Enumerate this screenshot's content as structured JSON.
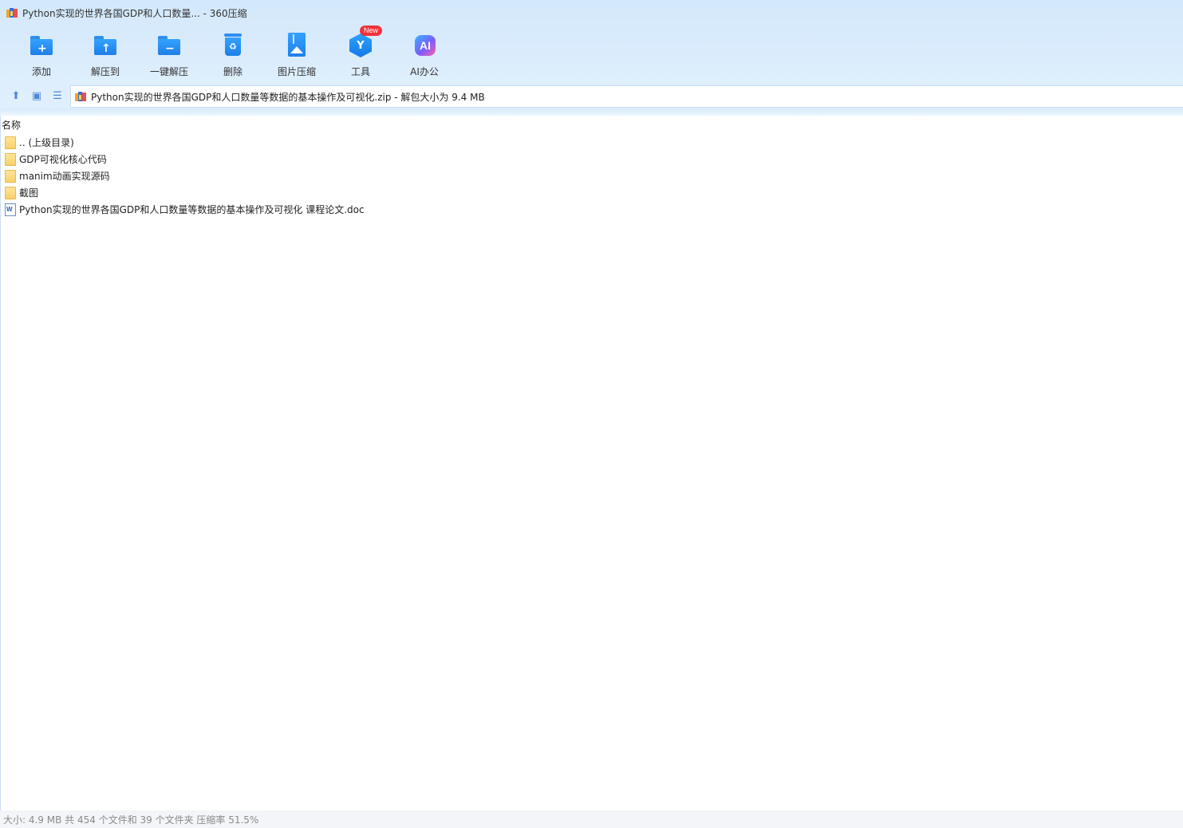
{
  "window": {
    "title": "Python实现的世界各国GDP和人口数量... - 360压缩"
  },
  "toolbar": {
    "items": [
      {
        "label": "添加",
        "icon": "add-folder-icon"
      },
      {
        "label": "解压到",
        "icon": "extract-to-icon"
      },
      {
        "label": "一键解压",
        "icon": "one-click-extract-icon"
      },
      {
        "label": "删除",
        "icon": "recycle-bin-icon"
      },
      {
        "label": "图片压缩",
        "icon": "image-compress-icon"
      },
      {
        "label": "工具",
        "icon": "tools-cube-icon",
        "badge": "New"
      },
      {
        "label": "AI办公",
        "icon": "ai-office-icon",
        "glyph": "AI"
      }
    ]
  },
  "address": {
    "path": "Python实现的世界各国GDP和人口数量等数据的基本操作及可视化.zip - 解包大小为 9.4 MB"
  },
  "filelist": {
    "column_name": "名称",
    "rows": [
      {
        "name": ".. (上级目录)",
        "type": "folder"
      },
      {
        "name": "GDP可视化核心代码",
        "type": "folder"
      },
      {
        "name": "manim动画实现源码",
        "type": "folder"
      },
      {
        "name": "截图",
        "type": "folder"
      },
      {
        "name": "Python实现的世界各国GDP和人口数量等数据的基本操作及可视化 课程论文.doc",
        "type": "doc"
      }
    ]
  },
  "status": {
    "text": "大小: 4.9 MB 共 454 个文件和 39 个文件夹 压缩率 51.5%"
  },
  "colors": {
    "accent": "#1f7fe8",
    "badge": "#f0333b"
  }
}
